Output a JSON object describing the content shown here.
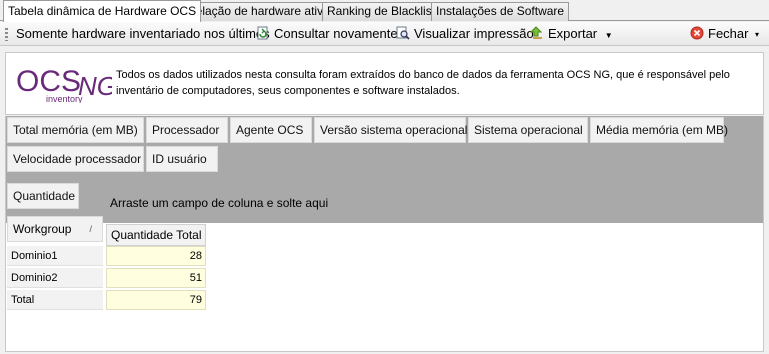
{
  "tabs": [
    {
      "label": "Tabela dinâmica de Hardware OCS"
    },
    {
      "label": "Relação de hardware ativo"
    },
    {
      "label": "Ranking de Blacklist"
    },
    {
      "label": "Instalações de Software"
    }
  ],
  "toolbar": {
    "filter_label": "Somente hardware inventariado nos últimos",
    "refresh_label": "Consultar novamente",
    "preview_label": "Visualizar impressão",
    "export_label": "Exportar",
    "close_label": "Fechar"
  },
  "banner": {
    "logo_text": "OCS",
    "logo_sub": "inventory",
    "logo_ng": "NG",
    "description": "Todos os dados utilizados nesta consulta foram extraídos do banco de dados da ferramenta OCS NG, que é responsável pelo inventário de computadores, seus componentes e software instalados."
  },
  "pivot": {
    "filter_fields": [
      "Total memória (em MB)",
      "Processador",
      "Agente OCS",
      "Versão sistema operacional",
      "Sistema operacional",
      "Média memória (em MB)",
      "Velocidade processador",
      "ID usuário"
    ],
    "data_field": "Quantidade",
    "column_drop_hint": "Arraste um campo de coluna e solte aqui",
    "row_field": "Workgroup",
    "column_header": "Quantidade Total",
    "rows": [
      {
        "label": "Dominio1",
        "value": "28"
      },
      {
        "label": "Dominio2",
        "value": "51"
      },
      {
        "label": "Total",
        "value": "79"
      }
    ]
  }
}
